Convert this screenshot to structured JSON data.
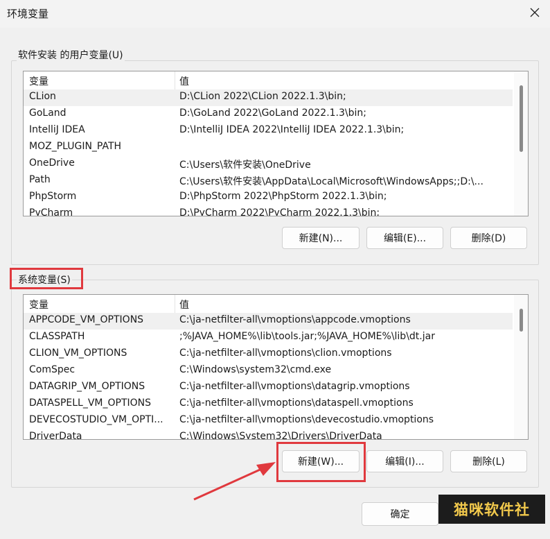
{
  "window": {
    "title": "环境变量"
  },
  "user_vars": {
    "group_label": "软件安装 的用户变量(U)",
    "col_name": "变量",
    "col_value": "值",
    "rows": [
      {
        "name": "CLion",
        "value": "D:\\CLion 2022\\CLion 2022.1.3\\bin;"
      },
      {
        "name": "GoLand",
        "value": "D:\\GoLand 2022\\GoLand 2022.1.3\\bin;"
      },
      {
        "name": "IntelliJ IDEA",
        "value": "D:\\IntelliJ IDEA 2022\\IntelliJ IDEA 2022.1.3\\bin;"
      },
      {
        "name": "MOZ_PLUGIN_PATH",
        "value": ""
      },
      {
        "name": "OneDrive",
        "value": "C:\\Users\\软件安装\\OneDrive"
      },
      {
        "name": "Path",
        "value": "C:\\Users\\软件安装\\AppData\\Local\\Microsoft\\WindowsApps;;D:\\..."
      },
      {
        "name": "PhpStorm",
        "value": "D:\\PhpStorm 2022\\PhpStorm 2022.1.3\\bin;"
      },
      {
        "name": "PyCharm",
        "value": "D:\\PyCharm 2022\\PyCharm 2022.1.3\\bin;"
      }
    ],
    "btn_new": "新建(N)...",
    "btn_edit": "编辑(E)...",
    "btn_delete": "删除(D)"
  },
  "sys_vars": {
    "group_label": "系统变量(S)",
    "col_name": "变量",
    "col_value": "值",
    "rows": [
      {
        "name": "APPCODE_VM_OPTIONS",
        "value": "C:\\ja-netfilter-all\\vmoptions\\appcode.vmoptions"
      },
      {
        "name": "CLASSPATH",
        "value": ";%JAVA_HOME%\\lib\\tools.jar;%JAVA_HOME%\\lib\\dt.jar"
      },
      {
        "name": "CLION_VM_OPTIONS",
        "value": "C:\\ja-netfilter-all\\vmoptions\\clion.vmoptions"
      },
      {
        "name": "ComSpec",
        "value": "C:\\Windows\\system32\\cmd.exe"
      },
      {
        "name": "DATAGRIP_VM_OPTIONS",
        "value": "C:\\ja-netfilter-all\\vmoptions\\datagrip.vmoptions"
      },
      {
        "name": "DATASPELL_VM_OPTIONS",
        "value": "C:\\ja-netfilter-all\\vmoptions\\dataspell.vmoptions"
      },
      {
        "name": "DEVECOSTUDIO_VM_OPTI...",
        "value": "C:\\ja-netfilter-all\\vmoptions\\devecostudio.vmoptions"
      },
      {
        "name": "DriverData",
        "value": "C:\\Windows\\System32\\Drivers\\DriverData"
      }
    ],
    "btn_new": "新建(W)...",
    "btn_edit": "编辑(I)...",
    "btn_delete": "删除(L)"
  },
  "footer": {
    "ok": "确定",
    "watermark": "猫咪软件社"
  },
  "colors": {
    "highlight": "#e0393e",
    "watermark_text": "#f2c94c"
  }
}
